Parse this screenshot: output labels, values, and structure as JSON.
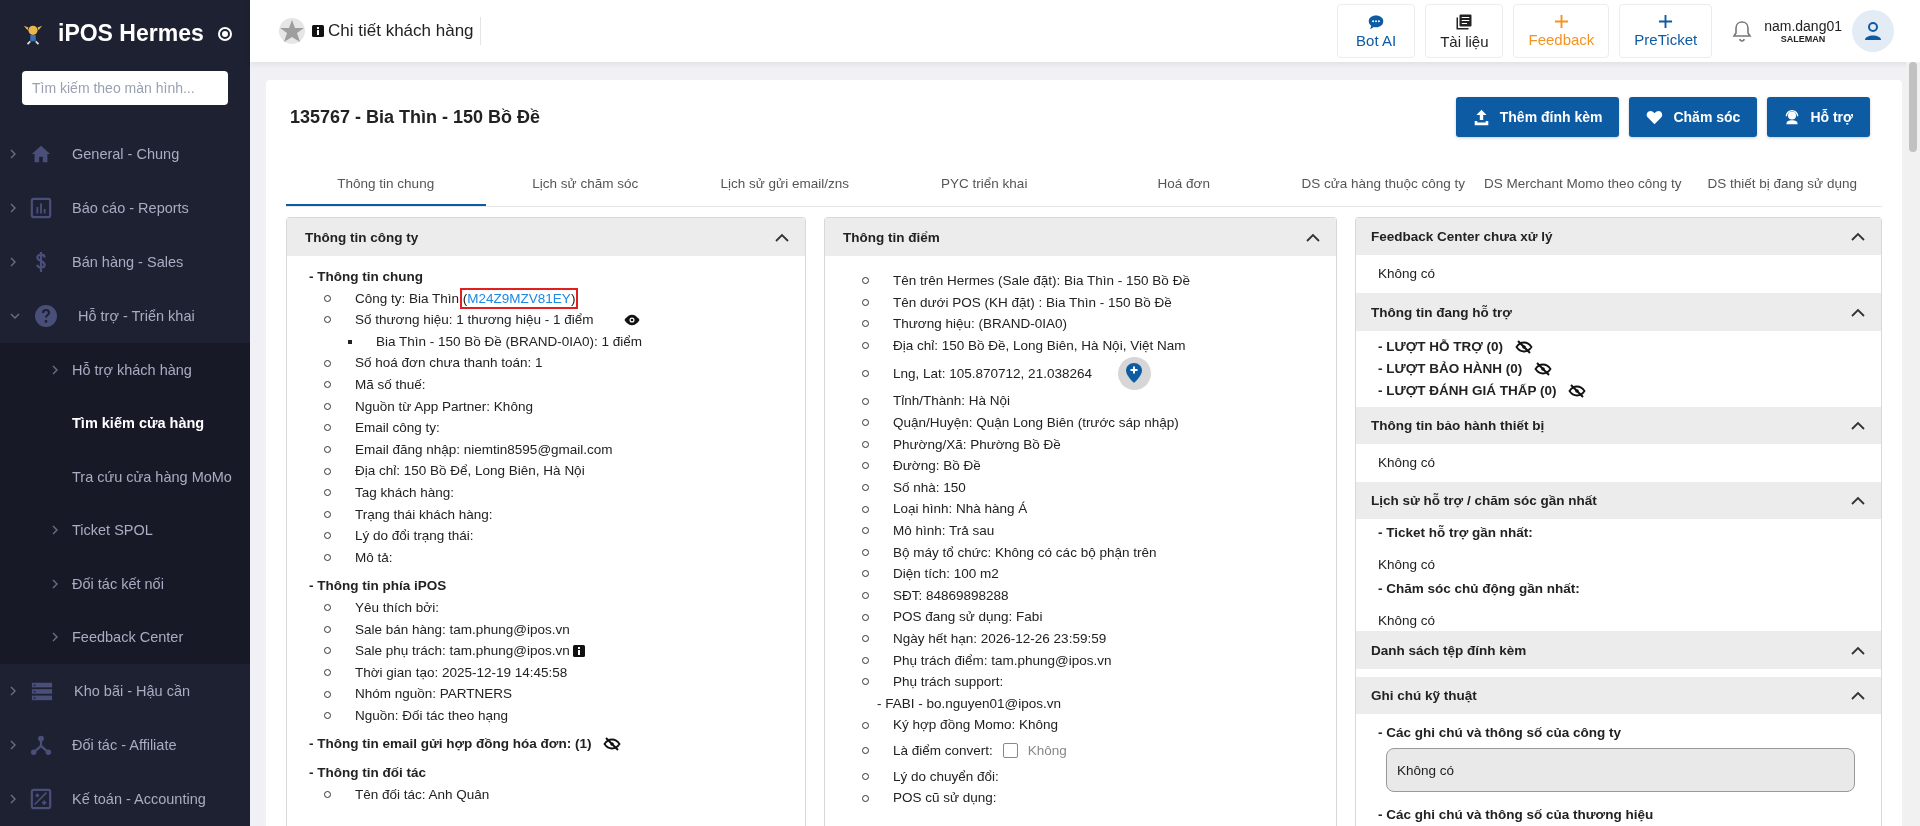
{
  "sidebar": {
    "brand": "iPOS Hermes",
    "search": {
      "placeholder": "Tìm kiếm theo màn hình..."
    },
    "items": [
      {
        "label": "General - Chung",
        "expanded": false
      },
      {
        "label": "Báo cáo - Reports",
        "expanded": false
      },
      {
        "label": "Bán hàng - Sales",
        "expanded": false
      },
      {
        "label": "Hỗ trợ - Triển khai",
        "expanded": true,
        "children": [
          {
            "label": "Hỗ trợ khách hàng",
            "expandable": true,
            "selected": false
          },
          {
            "label": "Tìm kiếm cửa hàng",
            "expandable": false,
            "selected": true
          },
          {
            "label": "Tra cứu cửa hàng MoMo",
            "expandable": false,
            "selected": false
          },
          {
            "label": "Ticket SPOL",
            "expandable": true,
            "selected": false
          },
          {
            "label": "Đối tác kết nối",
            "expandable": true,
            "selected": false
          },
          {
            "label": "Feedback Center",
            "expandable": true,
            "selected": false
          }
        ]
      },
      {
        "label": "Kho bãi - Hậu cần",
        "expanded": false
      },
      {
        "label": "Đối tác - Affiliate",
        "expanded": false
      },
      {
        "label": "Kế toán - Accounting",
        "expanded": false
      }
    ]
  },
  "header": {
    "title": "Chi tiết khách hàng",
    "buttons": [
      {
        "label": "Bot AI",
        "color": "#0d5ba3"
      },
      {
        "label": "Tài liệu",
        "color": "#222222"
      },
      {
        "label": "Feedback",
        "color": "#f39322"
      },
      {
        "label": "PreTicket",
        "color": "#0d5ba3"
      }
    ],
    "user": {
      "name": "nam.dang01",
      "role": "SALEMAN"
    }
  },
  "customer": {
    "title": "135767 - Bia Thìn - 150 Bồ Đề",
    "actions": [
      "Thêm đính kèm",
      "Chăm sóc",
      "Hỗ trợ"
    ],
    "tabs": [
      {
        "label": "Thông tin chung",
        "selected": true
      },
      {
        "label": "Lịch sử chăm sóc",
        "selected": false
      },
      {
        "label": "Lịch sử gửi email/zns",
        "selected": false
      },
      {
        "label": "PYC triển khai",
        "selected": false
      },
      {
        "label": "Hoá đơn",
        "selected": false
      },
      {
        "label": "DS cửa hàng thuộc công ty",
        "selected": false
      },
      {
        "label": "DS Merchant Momo theo công ty",
        "selected": false
      },
      {
        "label": "DS thiết bị đang sử dụng",
        "selected": false
      }
    ]
  },
  "company_panel": {
    "title": "Thông tin công ty",
    "expanded": true,
    "sections": [
      {
        "heading": "- Thông tin chung",
        "items": [
          {
            "kind": "link",
            "text": "Công ty: Bia Thìn",
            "open": "(",
            "code": "M24Z9MZV81EY",
            "close": ")",
            "highlighted": true
          },
          {
            "kind": "reveal",
            "text": "Số thương hiệu: 1 thương hiệu - 1 điểm",
            "revealed": true
          },
          {
            "kind": "sub",
            "text": "Bia Thìn - 150 Bồ Đề (BRAND-0IA0): 1 điểm"
          },
          {
            "kind": "text",
            "text": "Số hoá đơn chưa thanh toán: 1"
          },
          {
            "kind": "text",
            "text": "Mã số thuế:"
          },
          {
            "kind": "text",
            "text": "Nguồn từ App Partner: Không"
          },
          {
            "kind": "text",
            "text": "Email công ty:"
          },
          {
            "kind": "text",
            "text": "Email đăng nhập: niemtin8595@gmail.com"
          },
          {
            "kind": "text",
            "text": "Địa chỉ: 150 Bồ Để, Long Biên, Hà Nội"
          },
          {
            "kind": "text",
            "text": "Tag khách hàng:"
          },
          {
            "kind": "text",
            "text": "Trạng thái khách hàng:"
          },
          {
            "kind": "text",
            "text": "Lý do đổi trạng thái:"
          },
          {
            "kind": "text",
            "text": "Mô tả:"
          }
        ]
      },
      {
        "heading": "- Thông tin phía iPOS",
        "items": [
          {
            "kind": "text",
            "text": "Yêu thích bởi:"
          },
          {
            "kind": "text",
            "text": "Sale bán hàng: tam.phung@ipos.vn"
          },
          {
            "kind": "info",
            "text": "Sale phụ trách: tam.phung@ipos.vn"
          },
          {
            "kind": "text",
            "text": "Thời gian tạo: 2025-12-19 14:45:58"
          },
          {
            "kind": "text",
            "text": "Nhóm nguồn: PARTNERS"
          },
          {
            "kind": "text",
            "text": "Nguồn: Đối tác theo hạng"
          }
        ]
      },
      {
        "heading": "- Thông tin email gửi hợp đồng hóa đơn: (1)",
        "revealed": false
      },
      {
        "heading": "- Thông tin đối tác",
        "items": [
          {
            "kind": "text",
            "text": "Tên đối tác: Anh Quân"
          }
        ]
      }
    ]
  },
  "store_panel": {
    "title": "Thông tin điểm",
    "expanded": true,
    "items": [
      {
        "kind": "text",
        "text": "Tên trên Hermes (Sale đặt): Bia Thìn - 150 Bồ Đề"
      },
      {
        "kind": "text",
        "text": "Tên dưới POS (KH đặt) : Bia Thìn - 150 Bồ Đề"
      },
      {
        "kind": "text",
        "text": "Thương hiệu: (BRAND-0IA0)"
      },
      {
        "kind": "text",
        "text": "Địa chỉ: 150 Bồ Đề, Long Biên, Hà Nội, Việt Nam"
      },
      {
        "kind": "map",
        "text": "Lng, Lat: 105.870712, 21.038264"
      },
      {
        "kind": "text",
        "text": "Tỉnh/Thành: Hà Nội"
      },
      {
        "kind": "text",
        "text": "Quận/Huyện: Quận Long Biên (trước sáp nhập)"
      },
      {
        "kind": "text",
        "text": "Phường/Xã: Phường Bồ Đề"
      },
      {
        "kind": "text",
        "text": "Đường: Bồ Đề"
      },
      {
        "kind": "text",
        "text": "Số nhà: 150"
      },
      {
        "kind": "text",
        "text": "Loại hình: Nhà hàng Á"
      },
      {
        "kind": "text",
        "text": "Mô hình: Trả sau"
      },
      {
        "kind": "text",
        "text": "Bộ máy tổ chức: Không có các bộ phận trên"
      },
      {
        "kind": "text",
        "text": "Diện tích: 100 m2"
      },
      {
        "kind": "text",
        "text": "SĐT: 84869898288"
      },
      {
        "kind": "text",
        "text": "POS đang sử dụng: Fabi"
      },
      {
        "kind": "text",
        "text": "Ngày hết hạn: 2026-12-26 23:59:59"
      },
      {
        "kind": "text",
        "text": "Phụ trách điểm: tam.phung@ipos.vn"
      },
      {
        "kind": "text",
        "text": "Phụ trách support:"
      },
      {
        "kind": "note",
        "text": "- FABI - bo.nguyen01@ipos.vn"
      },
      {
        "kind": "text",
        "text": "Ký hợp đồng Momo: Không"
      },
      {
        "kind": "checkbox",
        "text": "Là điểm convert:",
        "checked": false,
        "option": "Không"
      },
      {
        "kind": "text",
        "text": "Lý do chuyển đổi:"
      },
      {
        "kind": "text",
        "text": "POS cũ sử dụng:"
      }
    ]
  },
  "side_panels": [
    {
      "title": "Feedback Center chưa xử lý",
      "expanded": true,
      "body": [
        {
          "kind": "muted",
          "text": "Không có"
        }
      ]
    },
    {
      "title": "Thông tin đang hỗ trợ",
      "expanded": true,
      "body": [
        {
          "kind": "count",
          "text": "- LƯỢT HỖ TRỢ (0)",
          "revealed": false
        },
        {
          "kind": "count",
          "text": "- LƯỢT BẢO HÀNH (0)",
          "revealed": false
        },
        {
          "kind": "count",
          "text": "- LƯỢT ĐÁNH GIÁ THẤP (0)",
          "revealed": false
        }
      ]
    },
    {
      "title": "Thông tin bảo hành thiết bị",
      "expanded": true,
      "body": [
        {
          "kind": "muted",
          "text": "Không có"
        }
      ]
    },
    {
      "title": "Lịch sử hỗ trợ / chăm sóc gần nhất",
      "expanded": true,
      "body": [
        {
          "kind": "subheading",
          "text": "- Ticket hỗ trợ gần nhất:"
        },
        {
          "kind": "muted",
          "text": "Không có"
        },
        {
          "kind": "subheading",
          "text": "- Chăm sóc chủ động gần nhất:"
        },
        {
          "kind": "muted",
          "text": "Không có"
        }
      ]
    },
    {
      "title": "Danh sách tệp đính kèm",
      "expanded": true
    },
    {
      "title": "Ghi chú kỹ thuật",
      "expanded": true,
      "body": [
        {
          "kind": "heading",
          "text": "- Các ghi chú và thông số của công ty"
        },
        {
          "kind": "field",
          "value": "Không có"
        },
        {
          "kind": "heading",
          "text": "- Các ghi chú và thông số của thương hiệu"
        }
      ]
    }
  ]
}
